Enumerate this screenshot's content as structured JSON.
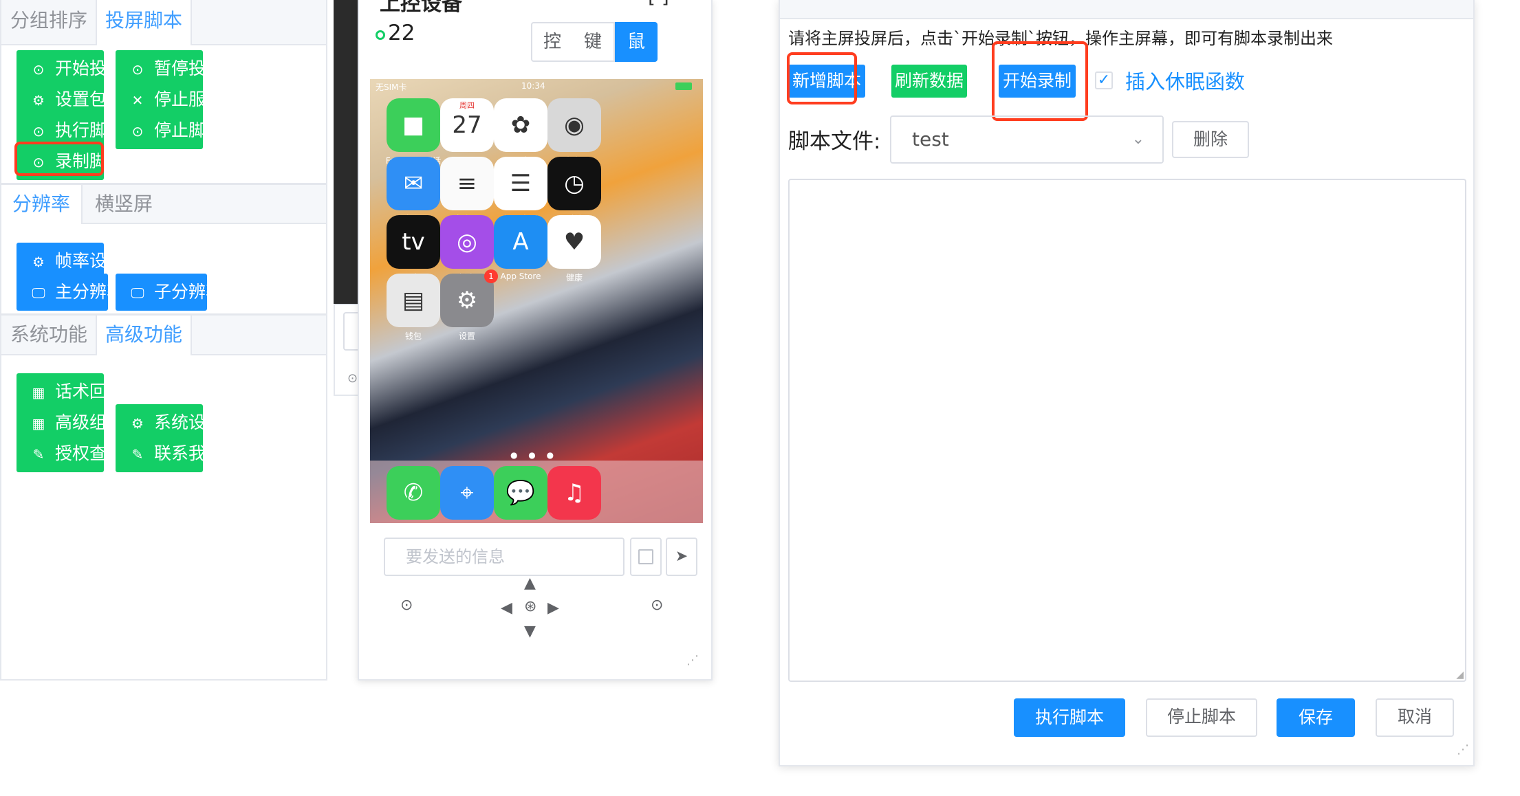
{
  "left_panel": {
    "section1": {
      "tabs": [
        "分组排序",
        "投屏脚本"
      ],
      "active_tab": "投屏脚本",
      "buttons": [
        {
          "label": "开始投屏",
          "icon": "play-circle-icon",
          "glyph": "⊙"
        },
        {
          "label": "暂停投屏",
          "icon": "pause-circle-icon",
          "glyph": "⊙"
        },
        {
          "label": "设置包名",
          "icon": "gear-icon",
          "glyph": "⚙"
        },
        {
          "label": "停止服务",
          "icon": "close-icon",
          "glyph": "✕"
        },
        {
          "label": "执行脚本",
          "icon": "play-circle-icon",
          "glyph": "⊙"
        },
        {
          "label": "停止脚本",
          "icon": "pause-circle-icon",
          "glyph": "⊙"
        },
        {
          "label": "录制脚本",
          "icon": "play-circle-icon",
          "glyph": "⊙"
        }
      ]
    },
    "section2": {
      "tabs": [
        "分辨率",
        "横竖屏"
      ],
      "active_tab": "分辨率",
      "buttons": [
        {
          "label": "帧率设置",
          "icon": "gear-icon",
          "glyph": "⚙"
        },
        {
          "label": "主分辨率",
          "icon": "monitor-icon",
          "glyph": "🖵"
        },
        {
          "label": "子分辨率",
          "icon": "monitor-icon",
          "glyph": "🖵"
        }
      ]
    },
    "section3": {
      "tabs": [
        "系统功能",
        "高级功能"
      ],
      "active_tab": "高级功能",
      "buttons": [
        {
          "label": "话术回复",
          "icon": "grid-icon",
          "glyph": "▦"
        },
        {
          "label": "高级组网",
          "icon": "grid-icon",
          "glyph": "▦"
        },
        {
          "label": "系统设置",
          "icon": "gear-icon",
          "glyph": "⚙"
        },
        {
          "label": "授权查询",
          "icon": "link-icon",
          "glyph": "✎"
        },
        {
          "label": "联系我们",
          "icon": "link-icon",
          "glyph": "✎"
        }
      ]
    }
  },
  "phone_panel": {
    "title": "上控设备",
    "device_id": "22",
    "modes": [
      "控",
      "键",
      "鼠"
    ],
    "active_mode": "鼠",
    "status_bar": {
      "carrier": "无SIM卡",
      "time": "10:34"
    },
    "apps": [
      {
        "label": "FaceTime通话",
        "glyph": "■",
        "color": "#3ccf5a"
      },
      {
        "label": "日历",
        "glyph": "27",
        "color": "#ffffff",
        "sub": "周四"
      },
      {
        "label": "照片",
        "glyph": "✿",
        "color": "#ffffff"
      },
      {
        "label": "相机",
        "glyph": "◉",
        "color": "#d8d8d8"
      },
      {
        "label": "邮件",
        "glyph": "✉",
        "color": "#2f8ff5"
      },
      {
        "label": "备忘录",
        "glyph": "≡",
        "color": "#fafafa"
      },
      {
        "label": "提醒事项",
        "glyph": "☰",
        "color": "#ffffff"
      },
      {
        "label": "时钟",
        "glyph": "◷",
        "color": "#111111"
      },
      {
        "label": "视频",
        "glyph": "tv",
        "color": "#111111"
      },
      {
        "label": "播客",
        "glyph": "◎",
        "color": "#a44ee8"
      },
      {
        "label": "App Store",
        "glyph": "A",
        "color": "#1e8ef3"
      },
      {
        "label": "健康",
        "glyph": "♥",
        "color": "#ffffff"
      },
      {
        "label": "钱包",
        "glyph": "▤",
        "color": "#e8e8e8"
      },
      {
        "label": "设置",
        "glyph": "⚙",
        "color": "#8a8a8e",
        "badge": "1"
      }
    ],
    "dock": [
      {
        "name": "phone-app-icon",
        "glyph": "✆",
        "color": "#3ccf5a"
      },
      {
        "name": "safari-app-icon",
        "glyph": "⌖",
        "color": "#2f8ff5"
      },
      {
        "name": "messages-app-icon",
        "glyph": "💬",
        "color": "#3ccf5a"
      },
      {
        "name": "music-app-icon",
        "glyph": "♫",
        "color": "#f3364c"
      }
    ],
    "message_placeholder": "要发送的信息"
  },
  "dialog": {
    "notice": "请将主屏投屏后，点击`开始录制`按钮，操作主屏幕，即可有脚本录制出来",
    "buttons": {
      "new_script": "新增脚本",
      "refresh": "刷新数据",
      "start_record": "开始录制"
    },
    "insert_sleep_label": "插入休眠函数",
    "insert_sleep_checked": true,
    "file_label": "脚本文件:",
    "file_value": "test",
    "delete": "删除",
    "footer": {
      "run": "执行脚本",
      "stop": "停止脚本",
      "save": "保存",
      "cancel": "取消"
    }
  },
  "colors": {
    "green": "#13ce66",
    "blue": "#1890ff",
    "highlight": "#ff3d1f"
  }
}
